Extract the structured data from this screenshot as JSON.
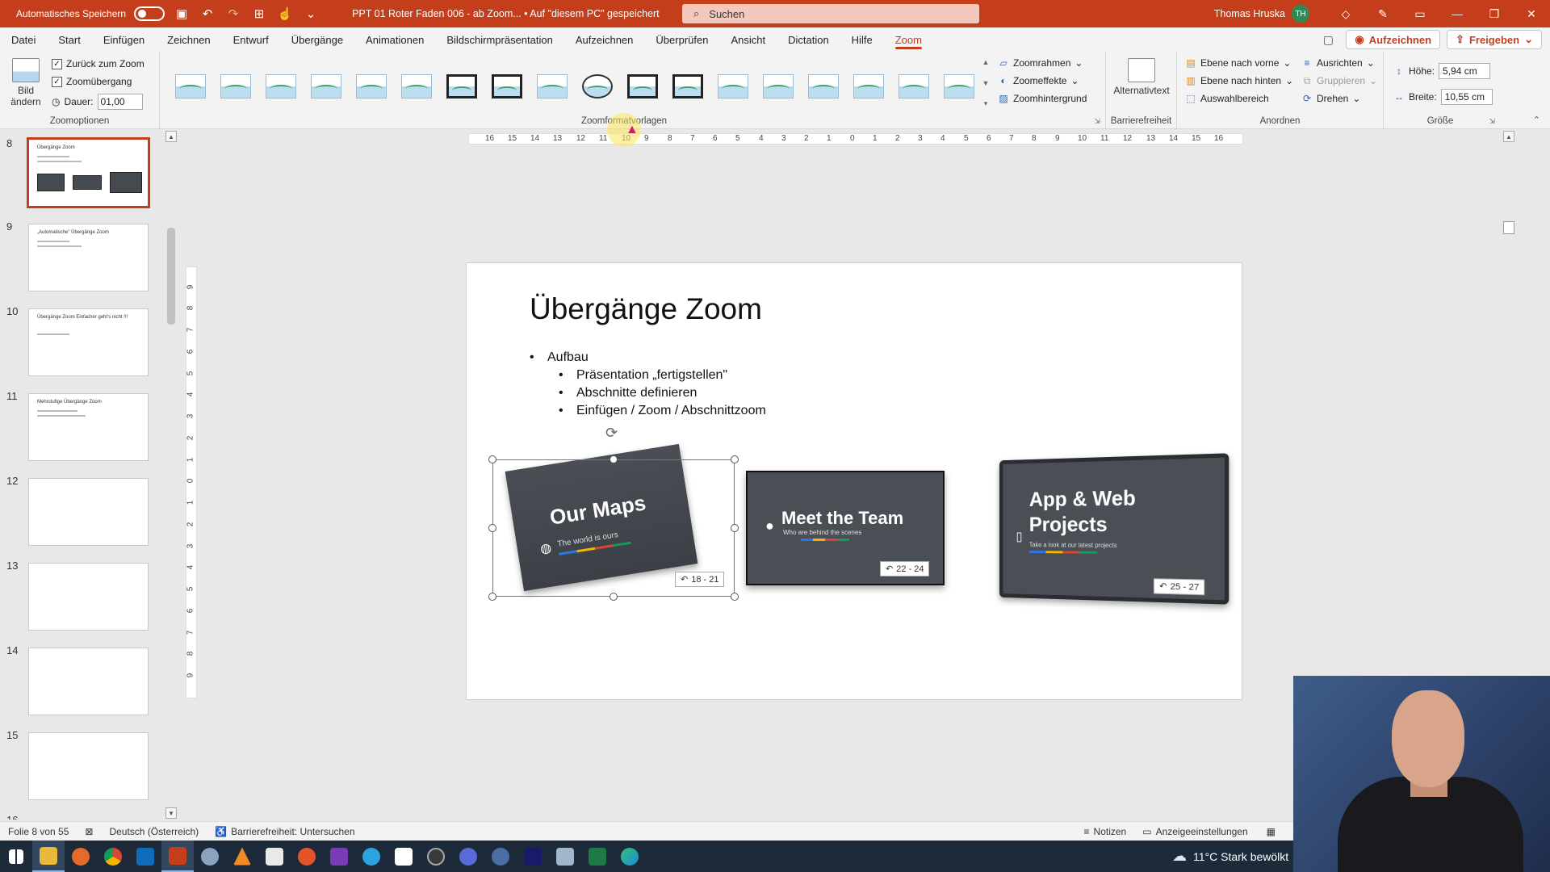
{
  "titlebar": {
    "autosave_label": "Automatisches Speichern",
    "document_title": "PPT 01 Roter Faden 006 - ab Zoom...  •  Auf \"diesem PC\" gespeichert",
    "search_placeholder": "Suchen",
    "user_name": "Thomas Hruska",
    "user_initials": "TH"
  },
  "tabs": [
    {
      "label": "Datei"
    },
    {
      "label": "Start"
    },
    {
      "label": "Einfügen"
    },
    {
      "label": "Zeichnen"
    },
    {
      "label": "Entwurf"
    },
    {
      "label": "Übergänge"
    },
    {
      "label": "Animationen"
    },
    {
      "label": "Bildschirmpräsentation"
    },
    {
      "label": "Aufzeichnen"
    },
    {
      "label": "Überprüfen"
    },
    {
      "label": "Ansicht"
    },
    {
      "label": "Dictation"
    },
    {
      "label": "Hilfe"
    },
    {
      "label": "Zoom"
    }
  ],
  "tabs_right": {
    "record_label": "Aufzeichnen",
    "share_label": "Freigeben"
  },
  "ribbon": {
    "zoomoptionen": {
      "change_image_label": "Bild ändern",
      "back_to_zoom_label": "Zurück zum Zoom",
      "zoom_transition_label": "Zoomübergang",
      "duration_label": "Dauer:",
      "duration_value": "01,00",
      "group_label": "Zoomoptionen"
    },
    "zoomformatvorlagen": {
      "group_label": "Zoomformatvorlagen",
      "frame_label": "Zoomrahmen",
      "effects_label": "Zoomeffekte",
      "background_label": "Zoomhintergrund"
    },
    "barrierefreiheit": {
      "alt_text_label": "Alternativtext",
      "group_label": "Barrierefreiheit"
    },
    "anordnen": {
      "bring_forward_label": "Ebene nach vorne",
      "send_backward_label": "Ebene nach hinten",
      "selection_pane_label": "Auswahlbereich",
      "align_label": "Ausrichten",
      "group_objects_label": "Gruppieren",
      "rotate_label": "Drehen",
      "group_label": "Anordnen"
    },
    "groesse": {
      "height_label": "Höhe:",
      "height_value": "5,94 cm",
      "width_label": "Breite:",
      "width_value": "10,55 cm",
      "group_label": "Größe"
    }
  },
  "thumbnails": {
    "items": [
      {
        "num": "8",
        "title": "Übergänge Zoom"
      },
      {
        "num": "9",
        "title": "„Automatische\" Übergänge Zoom"
      },
      {
        "num": "10",
        "title": "Übergänge Zoom  Einfacher geht's nicht !!!"
      },
      {
        "num": "11",
        "title": "Mehrstufige Übergänge Zoom"
      },
      {
        "num": "12",
        "title": ""
      },
      {
        "num": "13",
        "title": ""
      },
      {
        "num": "14",
        "title": ""
      },
      {
        "num": "15",
        "title": ""
      },
      {
        "num": "16",
        "title": ""
      }
    ]
  },
  "slide": {
    "title": "Übergänge Zoom",
    "bullet_main": "Aufbau",
    "bullets_sub": [
      "Präsentation „fertigstellen\"",
      "Abschnitte definieren",
      "Einfügen / Zoom / Abschnittzoom"
    ],
    "cards": [
      {
        "title": "Our Maps",
        "subtitle": "The world is ours",
        "range": "18 - 21"
      },
      {
        "title": "Meet the Team",
        "subtitle": "Who are behind the scenes",
        "range": "22 - 24"
      },
      {
        "title": "App & Web Projects",
        "subtitle": "Take a look at our latest projects",
        "range": "25 - 27"
      }
    ]
  },
  "statusbar": {
    "slide_info": "Folie 8 von 55",
    "language": "Deutsch (Österreich)",
    "accessibility": "Barrierefreiheit: Untersuchen",
    "notes": "Notizen",
    "display_settings": "Anzeigeeinstellungen"
  },
  "taskbar": {
    "weather": "11°C  Stark bewölkt"
  },
  "colors": {
    "accent": "#c43e1c",
    "ribbon_bg": "#f3f3f3",
    "taskbar_bg": "#1d2a3a"
  }
}
